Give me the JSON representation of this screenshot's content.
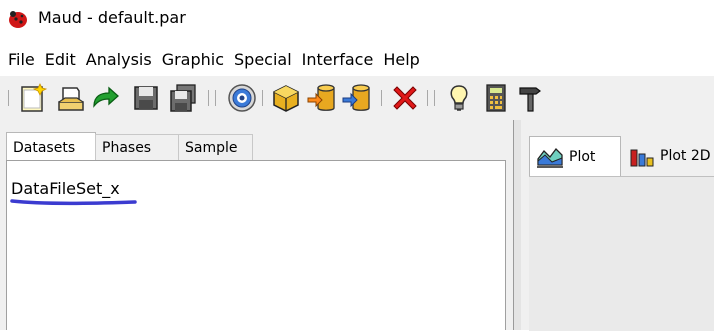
{
  "window": {
    "title": "Maud - default.par"
  },
  "menu": [
    "File",
    "Edit",
    "Analysis",
    "Graphic",
    "Special",
    "Interface",
    "Help"
  ],
  "toolbar": {
    "buttons": [
      {
        "name": "new-file-icon"
      },
      {
        "name": "open-file-icon"
      },
      {
        "name": "redo-arrow-icon"
      },
      {
        "name": "save-icon"
      },
      {
        "name": "save-as-icon"
      },
      {
        "name": "target-icon"
      },
      {
        "name": "cube-icon"
      },
      {
        "name": "database-import-icon"
      },
      {
        "name": "database-export-icon"
      },
      {
        "name": "delete-x-icon"
      },
      {
        "name": "lightbulb-icon"
      },
      {
        "name": "calculator-icon"
      },
      {
        "name": "hammer-icon"
      }
    ]
  },
  "left_tabs": [
    "Datasets",
    "Phases",
    "Sample"
  ],
  "active_left_tab": "Datasets",
  "datasets": [
    "DataFileSet_x"
  ],
  "right_tabs": [
    "Plot",
    "Plot 2D"
  ],
  "active_right_tab": "Plot",
  "colors": {
    "toolbar_bg": "#f0f0f0",
    "annotation": "#3b3bd0"
  }
}
